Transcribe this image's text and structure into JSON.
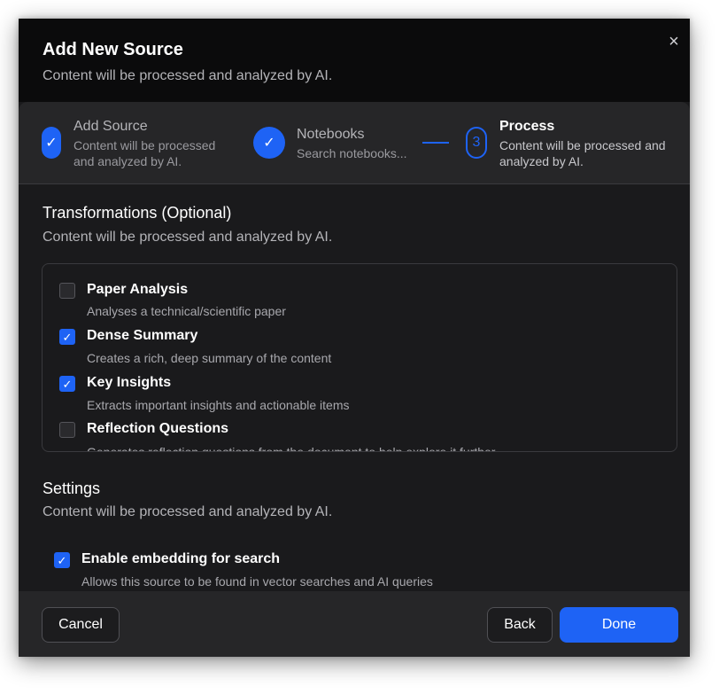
{
  "dialog": {
    "title": "Add New Source",
    "subtitle": "Content will be processed and analyzed by AI.",
    "close_glyph": "×"
  },
  "stepper": {
    "steps": [
      {
        "title": "Add Source",
        "desc_line1": "Content will be processed",
        "desc_line2": "and analyzed by AI.",
        "state": "complete",
        "glyph": "✓"
      },
      {
        "title": "Notebooks",
        "desc_line1": "Search notebooks...",
        "state": "complete",
        "glyph": "✓"
      },
      {
        "title": "Process",
        "desc_line1": "Content will be processed and",
        "desc_line2": "analyzed by AI.",
        "state": "active",
        "glyph": "3"
      }
    ]
  },
  "transformations": {
    "title": "Transformations (Optional)",
    "description": "Content will be processed and analyzed by AI.",
    "items": [
      {
        "name": "Paper Analysis",
        "desc": "Analyses a technical/scientific paper",
        "checked": false
      },
      {
        "name": "Dense Summary",
        "desc": "Creates a rich, deep summary of the content",
        "checked": true
      },
      {
        "name": "Key Insights",
        "desc": "Extracts important insights and actionable items",
        "checked": true
      },
      {
        "name": "Reflection Questions",
        "desc": "Generates reflection questions from the document to help explore it further",
        "checked": false
      }
    ]
  },
  "settings": {
    "title": "Settings",
    "description": "Content will be processed and analyzed by AI.",
    "embedding": {
      "label": "Enable embedding for search",
      "desc": "Allows this source to be found in vector searches and AI queries",
      "checked": true
    }
  },
  "footer": {
    "cancel_label": "Cancel",
    "back_label": "Back",
    "done_label": "Done"
  },
  "colors": {
    "accent": "#1e63f5",
    "background": "#1a1a1c",
    "header_background": "#0b0b0c",
    "panel_background": "#262628"
  },
  "icons": {
    "check": "check-icon",
    "close": "close-icon"
  }
}
